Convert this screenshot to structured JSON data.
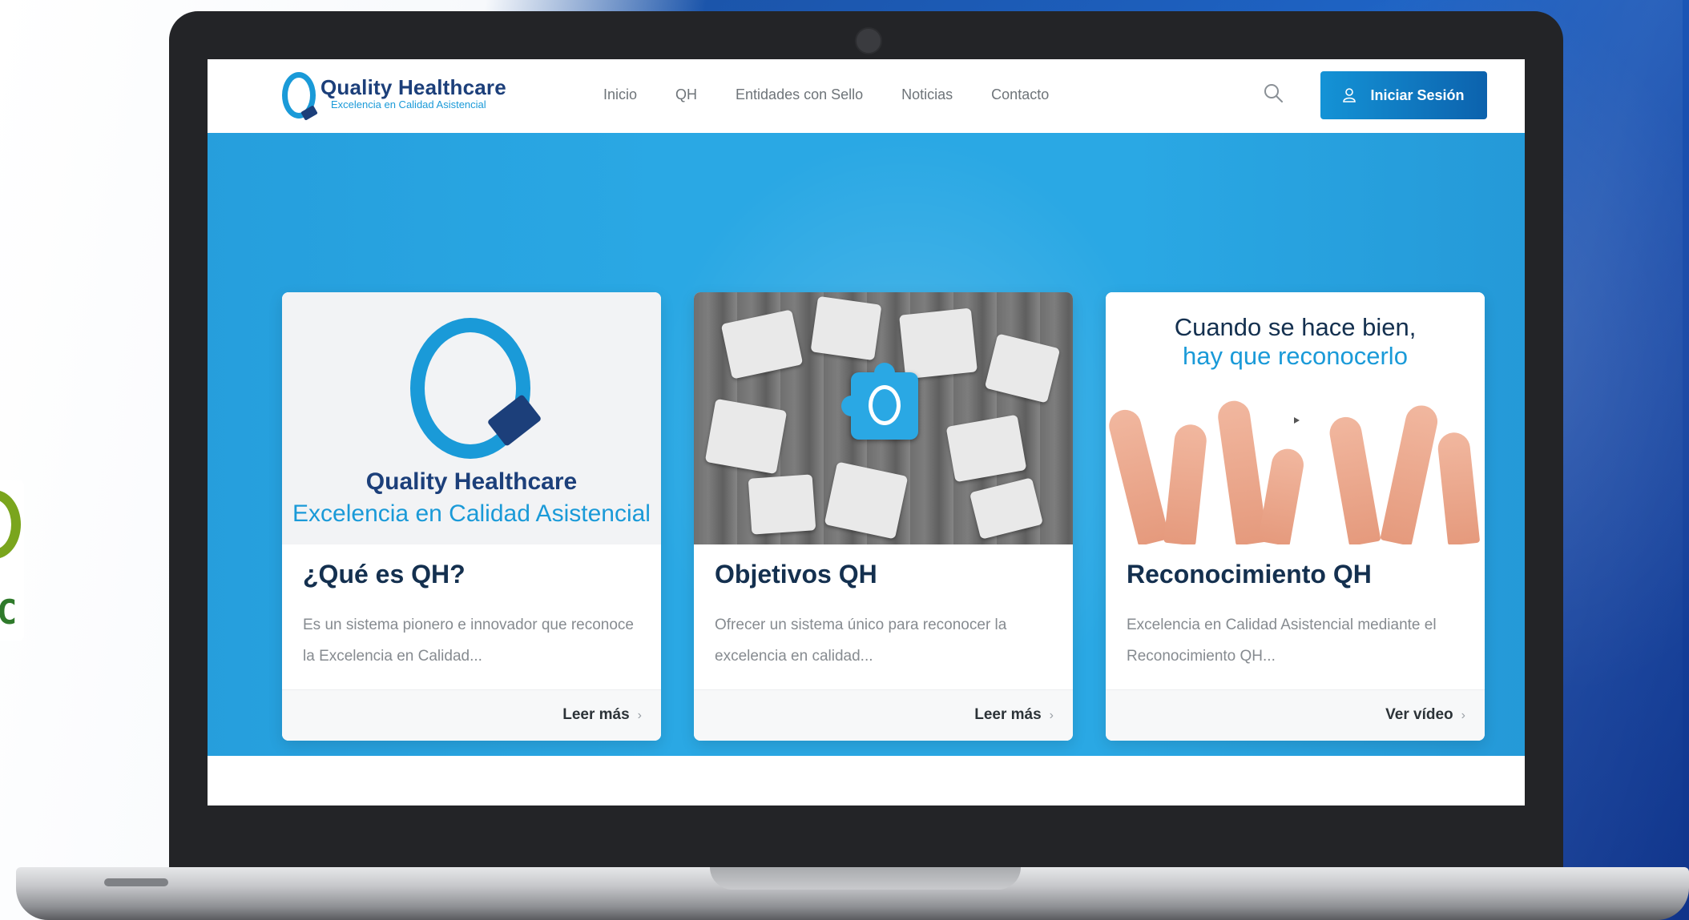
{
  "site": {
    "brand_name": "Quality Healthcare",
    "brand_tagline": "Excelencia en Calidad Asistencial"
  },
  "nav": {
    "items": [
      {
        "label": "Inicio"
      },
      {
        "label": "QH"
      },
      {
        "label": "Entidades con Sello"
      },
      {
        "label": "Noticias"
      },
      {
        "label": "Contacto"
      }
    ],
    "login_label": "Iniciar Sesión"
  },
  "icons": {
    "search": "search-icon",
    "login": "user-icon",
    "play": "play-icon"
  },
  "colors": {
    "hero": "#2aa8e4",
    "brand_dark": "#1c3f7a",
    "brand_light": "#1a9ad8",
    "button": "#0c62ad"
  },
  "cards": [
    {
      "title": "¿Qué es QH?",
      "text": "Es un sistema pionero e innovador que reconoce la Excelencia en Calidad...",
      "link": "Leer más",
      "media": {
        "brand_name": "Quality Healthcare",
        "brand_tagline": "Excelencia en Calidad Asistencial"
      }
    },
    {
      "title": "Objetivos QH",
      "text": "Ofrecer un sistema único para reconocer la excelencia en calidad...",
      "link": "Leer más"
    },
    {
      "title": "Reconocimiento QH",
      "text": "Excelencia en Calidad Asistencial mediante el Reconocimiento QH...",
      "link": "Ver vídeo",
      "media": {
        "line1": "Cuando se hace bien,",
        "line2": "hay que reconocerlo"
      }
    }
  ]
}
